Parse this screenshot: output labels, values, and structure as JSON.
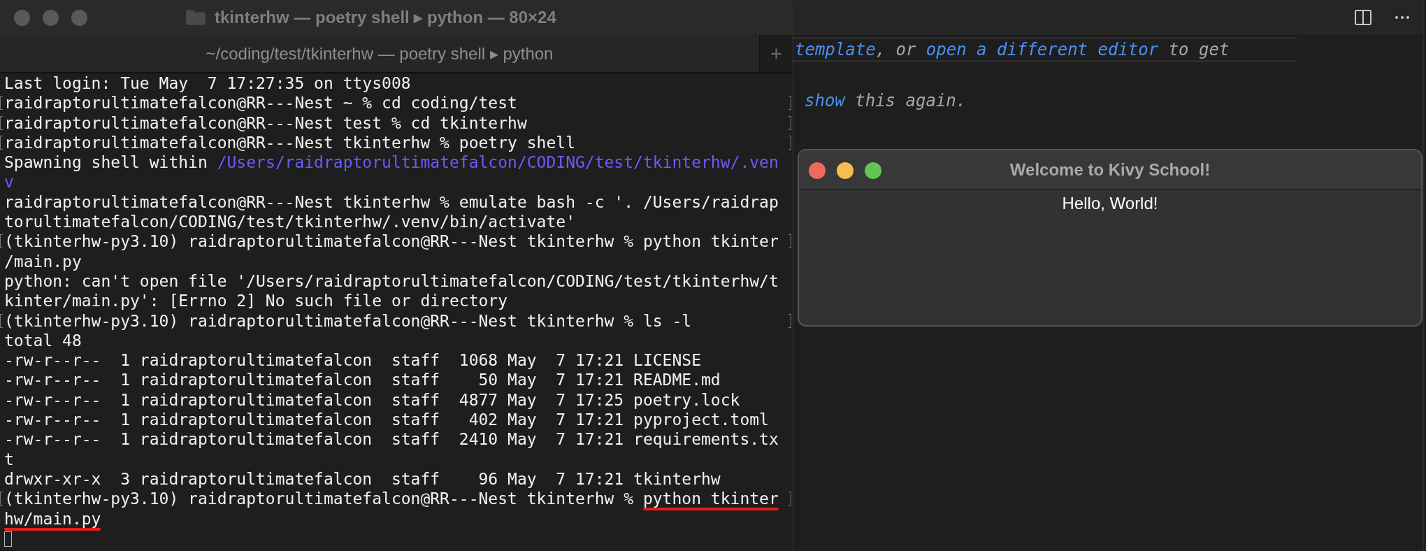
{
  "terminal": {
    "title": "tkinterhw — poetry shell ▸ python — 80×24",
    "tab": "~/coding/test/tkinterhw — poetry shell ▸ python",
    "new_tab": "+",
    "lines": [
      {
        "marked": false,
        "segments": [
          {
            "kind": "plain",
            "text": "Last login: Tue May  7 17:27:35 on ttys008"
          }
        ]
      },
      {
        "marked": true,
        "segments": [
          {
            "kind": "plain",
            "text": "raidraptorultimatefalcon@RR---Nest ~ % cd coding/test"
          }
        ]
      },
      {
        "marked": true,
        "segments": [
          {
            "kind": "plain",
            "text": "raidraptorultimatefalcon@RR---Nest test % cd tkinterhw"
          }
        ]
      },
      {
        "marked": true,
        "segments": [
          {
            "kind": "plain",
            "text": "raidraptorultimatefalcon@RR---Nest tkinterhw % poetry shell"
          }
        ]
      },
      {
        "marked": false,
        "segments": [
          {
            "kind": "plain",
            "text": "Spawning shell within "
          },
          {
            "kind": "link",
            "text": "/Users/raidraptorultimatefalcon/CODING/test/tkinterhw/.ven"
          }
        ]
      },
      {
        "marked": false,
        "segments": [
          {
            "kind": "link",
            "text": "v"
          }
        ]
      },
      {
        "marked": false,
        "segments": [
          {
            "kind": "plain",
            "text": "raidraptorultimatefalcon@RR---Nest tkinterhw % emulate bash -c '. /Users/raidrap"
          }
        ]
      },
      {
        "marked": false,
        "segments": [
          {
            "kind": "plain",
            "text": "torultimatefalcon/CODING/test/tkinterhw/.venv/bin/activate'"
          }
        ]
      },
      {
        "marked": true,
        "segments": [
          {
            "kind": "plain",
            "text": "(tkinterhw-py3.10) raidraptorultimatefalcon@RR---Nest tkinterhw % python tkinter"
          }
        ]
      },
      {
        "marked": false,
        "segments": [
          {
            "kind": "plain",
            "text": "/main.py"
          }
        ]
      },
      {
        "marked": false,
        "segments": [
          {
            "kind": "plain",
            "text": "python: can't open file '/Users/raidraptorultimatefalcon/CODING/test/tkinterhw/t"
          }
        ]
      },
      {
        "marked": false,
        "segments": [
          {
            "kind": "plain",
            "text": "kinter/main.py': [Errno 2] No such file or directory"
          }
        ]
      },
      {
        "marked": true,
        "segments": [
          {
            "kind": "plain",
            "text": "(tkinterhw-py3.10) raidraptorultimatefalcon@RR---Nest tkinterhw % ls -l"
          }
        ]
      },
      {
        "marked": false,
        "segments": [
          {
            "kind": "plain",
            "text": "total 48"
          }
        ]
      },
      {
        "marked": false,
        "segments": [
          {
            "kind": "plain",
            "text": "-rw-r--r--  1 raidraptorultimatefalcon  staff  1068 May  7 17:21 LICENSE"
          }
        ]
      },
      {
        "marked": false,
        "segments": [
          {
            "kind": "plain",
            "text": "-rw-r--r--  1 raidraptorultimatefalcon  staff    50 May  7 17:21 README.md"
          }
        ]
      },
      {
        "marked": false,
        "segments": [
          {
            "kind": "plain",
            "text": "-rw-r--r--  1 raidraptorultimatefalcon  staff  4877 May  7 17:25 poetry.lock"
          }
        ]
      },
      {
        "marked": false,
        "segments": [
          {
            "kind": "plain",
            "text": "-rw-r--r--  1 raidraptorultimatefalcon  staff   402 May  7 17:21 pyproject.toml"
          }
        ]
      },
      {
        "marked": false,
        "segments": [
          {
            "kind": "plain",
            "text": "-rw-r--r--  1 raidraptorultimatefalcon  staff  2410 May  7 17:21 requirements.tx"
          }
        ]
      },
      {
        "marked": false,
        "segments": [
          {
            "kind": "plain",
            "text": "t"
          }
        ]
      },
      {
        "marked": false,
        "segments": [
          {
            "kind": "plain",
            "text": "drwxr-xr-x  3 raidraptorultimatefalcon  staff    96 May  7 17:21 tkinterhw"
          }
        ]
      },
      {
        "marked": true,
        "segments": [
          {
            "kind": "plain",
            "text": "(tkinterhw-py3.10) raidraptorultimatefalcon@RR---Nest tkinterhw % "
          },
          {
            "kind": "underlined",
            "text": "python tkinter"
          }
        ]
      },
      {
        "marked": false,
        "segments": [
          {
            "kind": "underlined",
            "text": "hw/main.py"
          }
        ]
      },
      {
        "marked": false,
        "segments": [
          {
            "kind": "cursor"
          }
        ]
      }
    ]
  },
  "editor": {
    "lines": [
      [
        {
          "kind": "link",
          "text": "template"
        },
        {
          "kind": "plain",
          "text": ", or "
        },
        {
          "kind": "link",
          "text": "open a different editor"
        },
        {
          "kind": "plain",
          "text": " to get"
        }
      ],
      [
        {
          "kind": "link",
          "text": "show"
        },
        {
          "kind": "plain",
          "text": " this again."
        }
      ]
    ]
  },
  "kivy_window": {
    "title": "Welcome to Kivy School!",
    "label": "Hello, World!"
  }
}
